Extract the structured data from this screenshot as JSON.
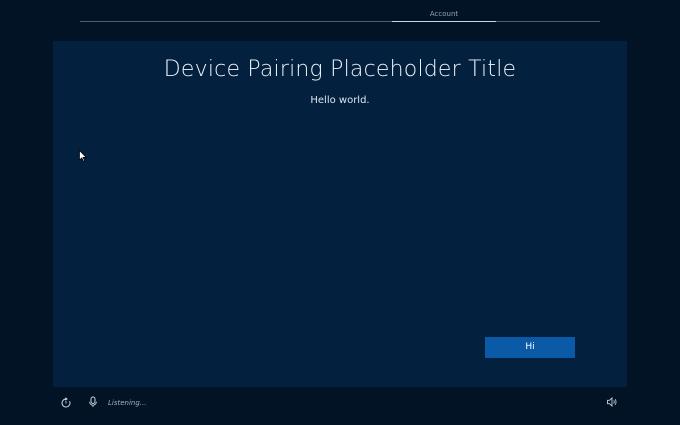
{
  "progress": {
    "steps": [
      "Account"
    ],
    "active_step": "Account"
  },
  "main": {
    "title": "Device Pairing Placeholder Title",
    "subtitle": "Hello world.",
    "button_label": "Hi"
  },
  "footer": {
    "ease_of_access_icon": "ease-of-access-icon",
    "microphone_icon": "microphone-icon",
    "status_text": "Listening...",
    "volume_icon": "speaker-icon"
  },
  "colors": {
    "background": "#021326",
    "panel": "#03213f",
    "accent_button": "#0b5aa8"
  }
}
